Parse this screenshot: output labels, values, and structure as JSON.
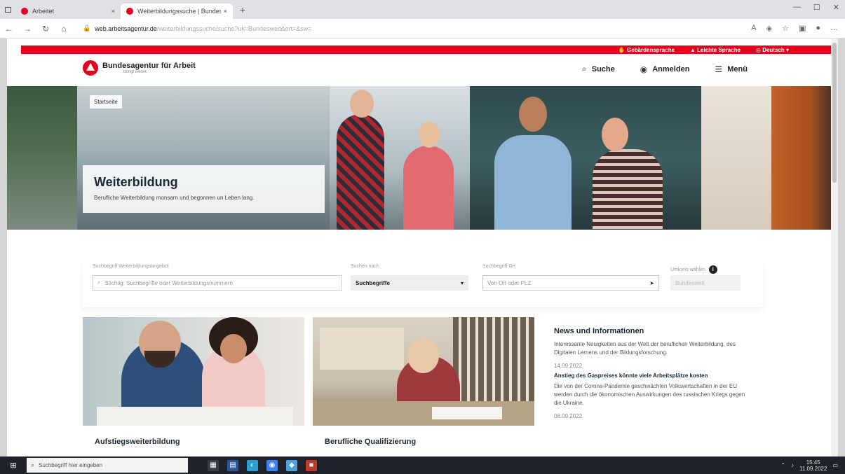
{
  "browser": {
    "tabs": [
      {
        "label": "Arbeitet",
        "active": false
      },
      {
        "label": "Weiterbildungssuche | Bundesa",
        "active": true
      }
    ],
    "url_host": "web.arbeitsagentur.de",
    "url_rest": "/weiterbildungssuche/suche?uk=Bundesweit&ort=&sw=",
    "close_tab": "×",
    "new_tab": "+"
  },
  "utility_bar": {
    "sign_language": "Gebärdensprache",
    "easy_language": "Leichte Sprache",
    "language": "Deutsch"
  },
  "header": {
    "brand": "Bundesagentur für Arbeit",
    "claim": "bringt weiter.",
    "search": "Suche",
    "login": "Anmelden",
    "menu": "Menü"
  },
  "hero": {
    "breadcrumb": "Startseite",
    "title": "Weiterbildung",
    "subtitle": "Berufliche Weiterbildung monsarn und begonnen un Leben lang."
  },
  "search": {
    "keyword_label": "Suchbegriff Weiterbildungsangebot",
    "keyword_placeholder": "Stichtig: Suchbegriffe oder Weiterbildungsnummern",
    "search_in_label": "Suchen nach",
    "search_in_value": "Suchbegriffe",
    "location_label": "Suchbegriff Ort",
    "location_placeholder": "Von Ort oder PLZ",
    "radius_label": "Umkreis wählen",
    "radius_value": "Bundesweit",
    "info": "i"
  },
  "cards": [
    {
      "title": "Aufstiegsweiterbildung"
    },
    {
      "title": "Berufliche Qualifizierung"
    }
  ],
  "news": {
    "heading": "News und Informationen",
    "intro": "Interessante Neuigkeiten aus der Welt der beruflichen Weiterbildung, des Digitalen Lernens und der Bildungsforschung.",
    "items": [
      {
        "date": "14.09.2022",
        "headline": "Anstieg des Gaspreises könnte viele Arbeitsplätze kosten",
        "teaser": "Die von der Corona-Pandemie geschwächten Volkswirtschaften in der EU werden durch die ökonomischen Auswirkungen des russischen Kriegs gegen die Ukraine."
      },
      {
        "date": "08.09.2022"
      }
    ]
  },
  "taskbar": {
    "search_placeholder": "Suchbegriff hier eingeben",
    "time": "15:45",
    "date": "11.09.2022"
  },
  "colors": {
    "brand_red": "#e2001a",
    "text_dark": "#1c2a33"
  }
}
